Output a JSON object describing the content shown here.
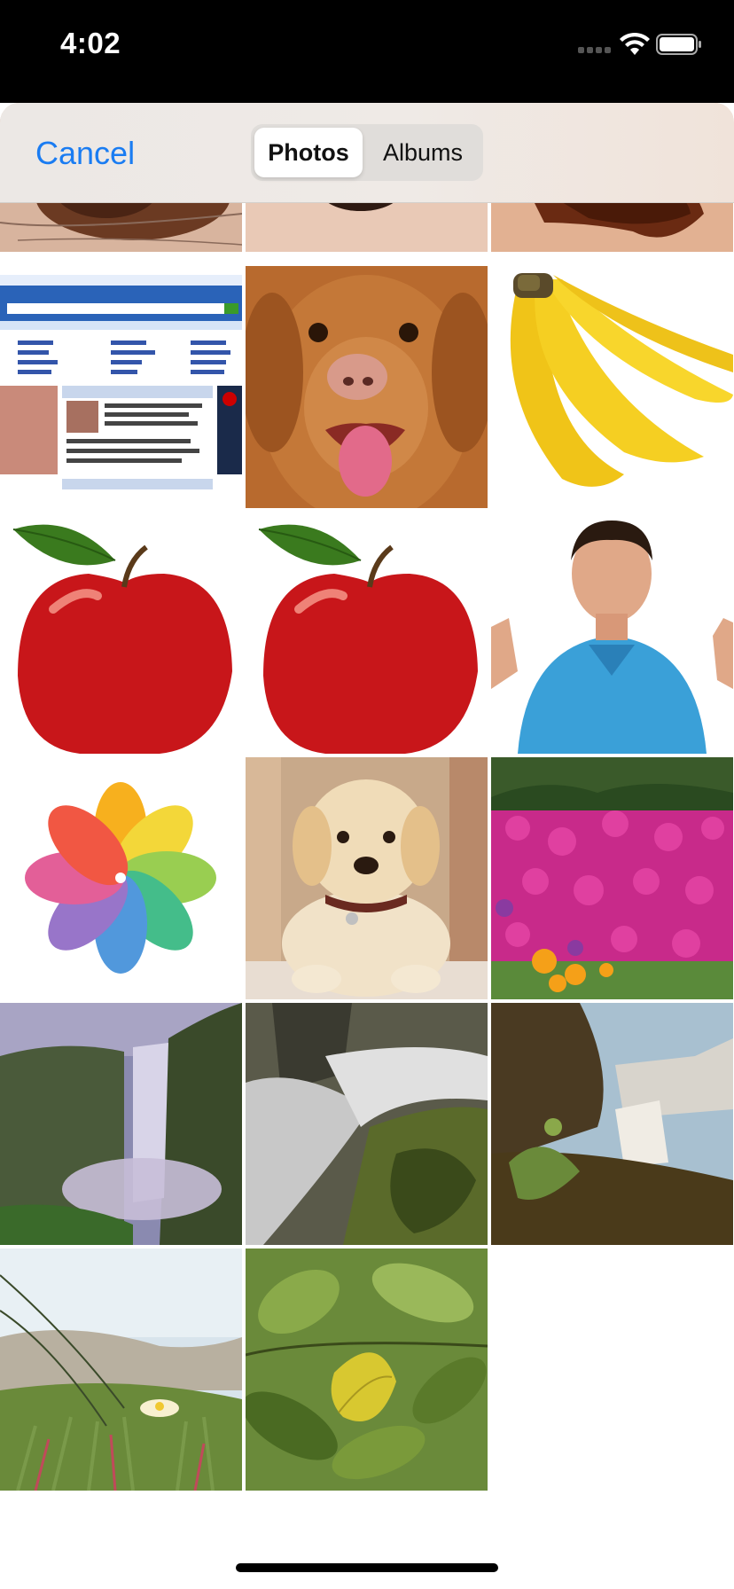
{
  "status_bar": {
    "time": "4:02"
  },
  "nav": {
    "cancel_label": "Cancel",
    "segments": [
      {
        "label": "Photos",
        "selected": true
      },
      {
        "label": "Albums",
        "selected": false
      }
    ],
    "accent_color": "#1a7cf2"
  },
  "photos": [
    {
      "name": "skin-mole-1",
      "icon": "skin-photo"
    },
    {
      "name": "skin-mole-2",
      "icon": "skin-photo"
    },
    {
      "name": "skin-mole-3",
      "icon": "skin-photo"
    },
    {
      "name": "msn-webpage",
      "icon": "webpage-screenshot"
    },
    {
      "name": "dog",
      "icon": "dog-photo"
    },
    {
      "name": "bananas",
      "icon": "banana-photo"
    },
    {
      "name": "apple-1",
      "icon": "apple-photo"
    },
    {
      "name": "apple-2",
      "icon": "apple-photo"
    },
    {
      "name": "man-thumbs-up",
      "icon": "person-photo"
    },
    {
      "name": "photos-app-logo",
      "icon": "photos-app-icon"
    },
    {
      "name": "puppy",
      "icon": "puppy-photo"
    },
    {
      "name": "pink-flowers",
      "icon": "flowers-photo"
    },
    {
      "name": "waterfall-1",
      "icon": "waterfall-photo"
    },
    {
      "name": "waterfall-2",
      "icon": "waterfall-photo"
    },
    {
      "name": "waterfall-3",
      "icon": "waterfall-photo"
    },
    {
      "name": "dune-flower",
      "icon": "plant-photo"
    },
    {
      "name": "leaves",
      "icon": "leaves-photo"
    }
  ]
}
